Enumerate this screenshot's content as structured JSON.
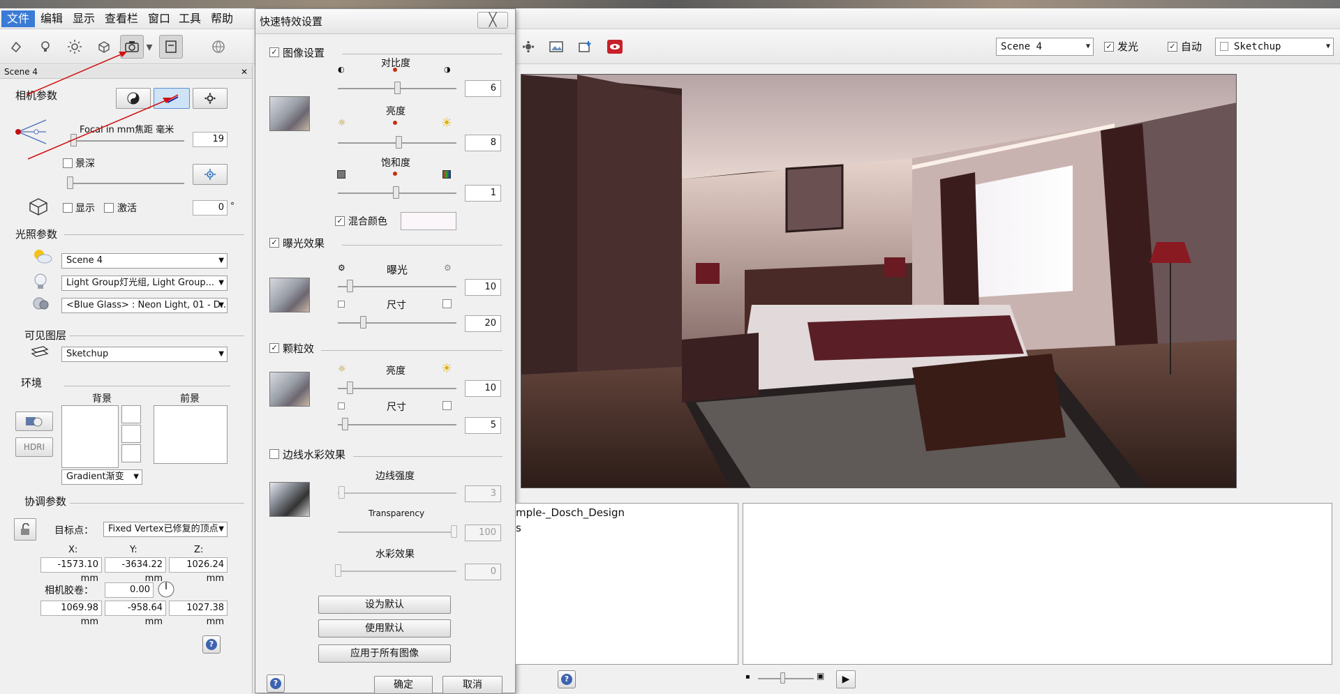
{
  "menubar": {
    "items": [
      "文件",
      "编辑",
      "显示",
      "查看栏",
      "窗口",
      "工具",
      "帮助"
    ]
  },
  "toolbar": {
    "scene_select": "Scene 4",
    "glow_label": "发光",
    "auto_label": "自动",
    "layer_select": "Sketchup"
  },
  "left_panel": {
    "header": "Scene 4",
    "camera_params": "相机参数",
    "focal_label": "Focal in mm焦距 毫米",
    "focal_value": "19",
    "dof_label": "景深",
    "show_label": "显示",
    "activate_label": "激活",
    "angle_value": "0",
    "angle_unit": "°",
    "lighting_params": "光照参数",
    "sun_select": "Scene 4",
    "light_group_select": "Light Group灯光组, Light Group...",
    "material_select": "<Blue Glass> : Neon Light, 01 - D...",
    "visible_layers": "可见图层",
    "layer_select": "Sketchup",
    "environment": "环境",
    "background": "背景",
    "foreground": "前景",
    "hdri": "HDRI",
    "gradient_select": "Gradient渐变",
    "coord_params": "协调参数",
    "target_label": "目标点：",
    "target_select": "Fixed Vertex已修复的顶点",
    "x_label": "X:",
    "y_label": "Y:",
    "z_label": "Z:",
    "x_value": "-1573.10 mm",
    "y_value": "-3634.22 mm",
    "z_value": "1026.24 mm",
    "roll_label": "相机胶卷：",
    "roll_value": "0.00",
    "pos_x": "1069.98 mm",
    "pos_y": "-958.64 mm",
    "pos_z": "1027.38 mm"
  },
  "dialog": {
    "title": "快速特效设置",
    "close": "╳",
    "image_settings": "图像设置",
    "contrast_label": "对比度",
    "contrast_value": "6",
    "brightness_label": "亮度",
    "brightness_value": "8",
    "saturation_label": "饱和度",
    "saturation_value": "1",
    "blend_color_label": "混合颜色",
    "exposure_effect": "曝光效果",
    "exposure_label": "曝光",
    "exposure_value": "10",
    "size_label": "尺寸",
    "exposure_size_value": "20",
    "grain_label": "颗粒效",
    "grain_brightness_label": "亮度",
    "grain_brightness_value": "10",
    "grain_size_label": "尺寸",
    "grain_size_value": "5",
    "edge_watercolor": "边线水彩效果",
    "edge_strength_label": "边线强度",
    "edge_strength_value": "3",
    "transparency_label": "Transparency",
    "transparency_value": "100",
    "watercolor_label": "水彩效果",
    "watercolor_value": "0",
    "set_default": "设为默认",
    "use_default": "使用默认",
    "apply_all": "应用于所有图像",
    "ok": "确定",
    "cancel": "取消"
  },
  "bottom": {
    "file_text": "mple-_Dosch_Design",
    "file_text2": "s"
  },
  "colors": {
    "accent": "#3a7bd5",
    "red_line": "#d01010"
  }
}
